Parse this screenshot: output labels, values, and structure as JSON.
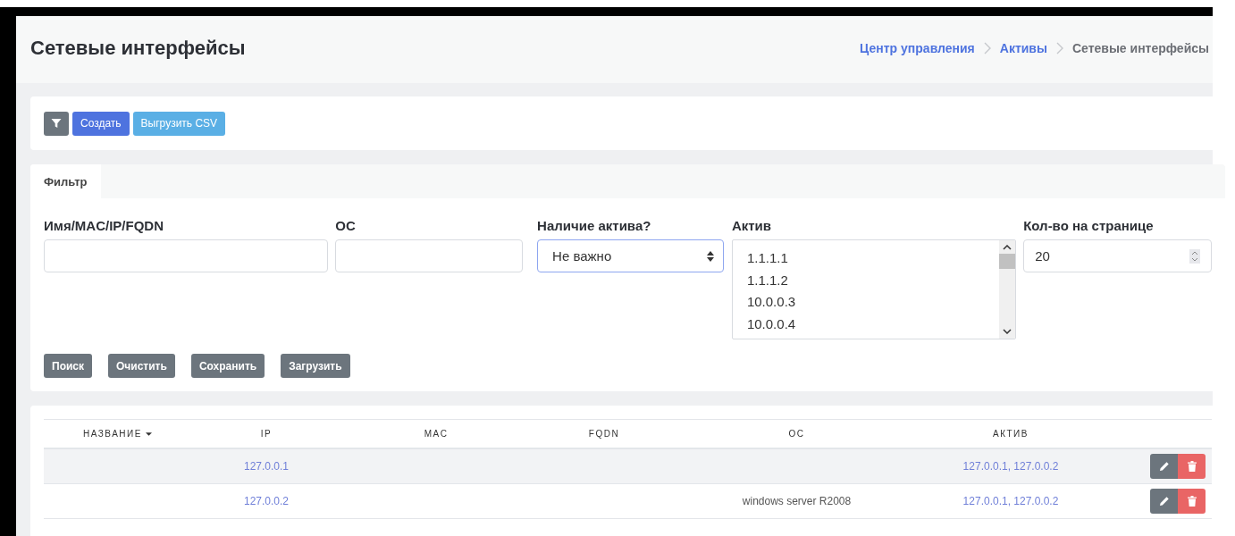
{
  "page": {
    "title": "Сетевые интерфейсы"
  },
  "breadcrumbs": [
    "Центр управления",
    "Активы",
    "Сетевые интерфейсы"
  ],
  "toolbar": {
    "buttons": [
      {
        "kind": "filter"
      },
      {
        "kind": "primary",
        "label": "Создать"
      },
      {
        "kind": "info",
        "label": "Выгрузить CSV"
      }
    ]
  },
  "filter": {
    "tabs": [
      {
        "label": "Фильтр",
        "selected": true
      }
    ],
    "fields": [
      {
        "kind": "text",
        "label": "Имя/MAC/IP/FQDN"
      },
      {
        "kind": "text",
        "label": "ОС"
      },
      {
        "kind": "select",
        "label": "Наличие актива?",
        "value": "Не важно"
      },
      {
        "kind": "list",
        "label": "Актив",
        "options": [
          "1.1.1.1",
          "1.1.1.2",
          "10.0.0.3",
          "10.0.0.4"
        ]
      },
      {
        "kind": "number",
        "label": "Кол-во на странице",
        "value": "20"
      }
    ],
    "buttons": [
      "Поиск",
      "Очистить",
      "Сохранить",
      "Загрузить"
    ]
  },
  "table": {
    "columns": [
      {
        "label": "НАЗВАНИЕ",
        "sorted": true
      },
      {
        "label": "IP",
        "sorted": false
      },
      {
        "label": "MAC",
        "sorted": false
      },
      {
        "label": "FQDN",
        "sorted": false
      },
      {
        "label": "ОС",
        "sorted": false
      },
      {
        "label": "АКТИВ",
        "sorted": false
      }
    ],
    "rows": [
      {
        "ip": "127.0.0.1",
        "asset": "127.0.0.1, 127.0.0.2"
      },
      {
        "ip": "127.0.0.2",
        "os": "windows server R2008",
        "asset": "127.0.0.1, 127.0.0.2"
      }
    ]
  }
}
